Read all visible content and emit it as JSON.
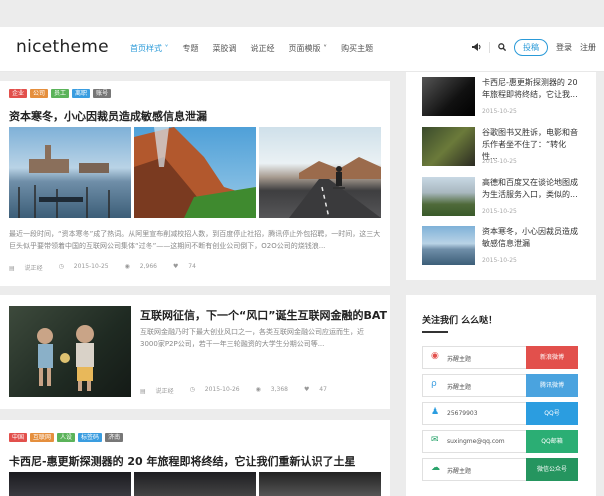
{
  "header": {
    "logo": "nicetheme",
    "nav": [
      {
        "label": "首页样式",
        "chevron": true,
        "active": true
      },
      {
        "label": "专题",
        "chevron": false,
        "active": false
      },
      {
        "label": "菜胶调",
        "chevron": false,
        "active": false
      },
      {
        "label": "说正经",
        "chevron": false,
        "active": false
      },
      {
        "label": "页面模版",
        "chevron": true,
        "active": false
      },
      {
        "label": "购买主题",
        "chevron": false,
        "active": false
      }
    ],
    "post_button": "投稿",
    "login": "登录",
    "register": "注册"
  },
  "posts": [
    {
      "tags": [
        {
          "label": "企业",
          "color": "#e2504c"
        },
        {
          "label": "公司",
          "color": "#e58f3d"
        },
        {
          "label": "员工",
          "color": "#5bb35a"
        },
        {
          "label": "离职",
          "color": "#3a9de0"
        },
        {
          "label": "账号",
          "color": "#777777"
        }
      ],
      "title": "资本寒冬，小心因裁员造成敏感信息泄漏",
      "excerpt": "最近一段时间，“资本寒冬”成了热词。从阿里宣布削减校招人数，到百度停止社招，腾讯停止外包招聘，一时间，这三大巨头似乎要带领着中国的互联网公司集体“过冬”——这期间不断有创业公司倒下，O2O公司的烧钱浪...",
      "author": "说正经",
      "date": "2015-10-25",
      "views": "2,966",
      "likes": "74"
    },
    {
      "title": "互联网征信，下一个“风口”诞生互联网金融的BAT",
      "excerpt": "互联网金融乃时下最大创业风口之一，各类互联网金融公司应运而生，近3000家P2P公司，若干一年三轮融资的大学生分期公司等...",
      "author": "说正经",
      "date": "2015-10-26",
      "views": "3,368",
      "likes": "47"
    },
    {
      "tags": [
        {
          "label": "中国",
          "color": "#e2504c"
        },
        {
          "label": "互联网",
          "color": "#e58f3d"
        },
        {
          "label": "人设",
          "color": "#5bb35a"
        },
        {
          "label": "标签码",
          "color": "#3a9de0"
        },
        {
          "label": "济南",
          "color": "#777777"
        }
      ],
      "title": "卡西尼-惠更斯探测器的 20 年旅程即将终结，它让我们重新认识了土星"
    }
  ],
  "sidebar": {
    "items": [
      {
        "title": "卡西尼-惠更斯探测器的 20 年旅程即将终结，它让我...",
        "date": "2015-10-25"
      },
      {
        "title": "谷歌图书又胜诉，电影和音乐作者坐不住了：“转化性...",
        "date": "2015-10-25"
      },
      {
        "title": "高德和百度又在谈论地图成为生活服务入口，类似的...",
        "date": "2015-10-25"
      },
      {
        "title": "资本寒冬，小心因裁员造成敏感信息泄漏",
        "date": "2015-10-25"
      }
    ],
    "follow_title": "关注我们 么么哒！",
    "follow": [
      {
        "icon": "weibo-icon",
        "glyph": "◉",
        "icon_color": "#e2504c",
        "text": "苏醒主题",
        "button": "新浪微博",
        "color": "#e2504c"
      },
      {
        "icon": "tencent-weibo-icon",
        "glyph": "ρ",
        "icon_color": "#3a9de0",
        "text": "苏醒主题",
        "button": "腾讯微博",
        "color": "#4aa3df"
      },
      {
        "icon": "qq-icon",
        "glyph": "♟",
        "icon_color": "#2b9de0",
        "text": "25679903",
        "button": "QQ号",
        "color": "#2b9de0"
      },
      {
        "icon": "email-icon",
        "glyph": "✉",
        "icon_color": "#29a36b",
        "text": "suxingme@qq.com",
        "button": "QQ邮箱",
        "color": "#2bae74"
      },
      {
        "icon": "wechat-icon",
        "glyph": "☁",
        "icon_color": "#29a36b",
        "text": "苏醒主题",
        "button": "微信公众号",
        "color": "#25955f"
      }
    ]
  }
}
